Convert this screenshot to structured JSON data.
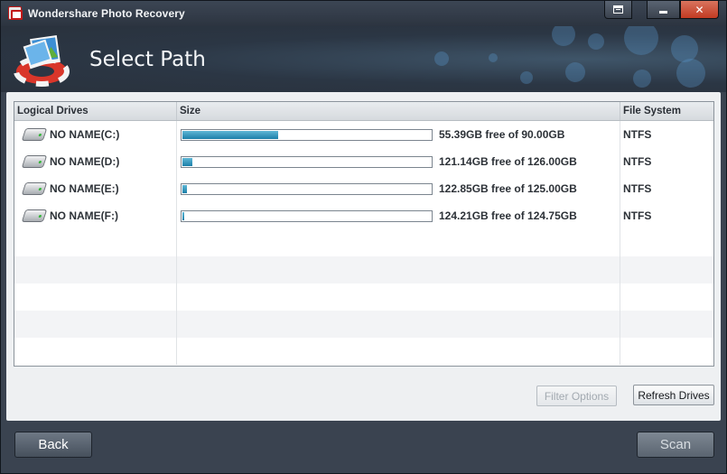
{
  "window": {
    "title": "Wondershare Photo Recovery",
    "close_glyph": "✕",
    "min_icon": "minimize-icon",
    "restore_icon": "restore-icon"
  },
  "header": {
    "page_title": "Select Path",
    "logo_icon": "photo-recovery-logo-icon"
  },
  "table": {
    "columns": [
      "Logical Drives",
      "Size",
      "File System"
    ],
    "rows": [
      {
        "drive": "NO NAME(C:)",
        "size_text": "55.39GB free of 90.00GB",
        "used_fraction": 0.385,
        "fs": "NTFS"
      },
      {
        "drive": "NO NAME(D:)",
        "size_text": "121.14GB free of 126.00GB",
        "used_fraction": 0.039,
        "fs": "NTFS"
      },
      {
        "drive": "NO NAME(E:)",
        "size_text": "122.85GB free of 125.00GB",
        "used_fraction": 0.017,
        "fs": "NTFS"
      },
      {
        "drive": "NO NAME(F:)",
        "size_text": "124.21GB free of 124.75GB",
        "used_fraction": 0.004,
        "fs": "NTFS"
      }
    ]
  },
  "buttons": {
    "filter_options": "Filter Options",
    "refresh_drives": "Refresh Drives",
    "back": "Back",
    "scan": "Scan"
  },
  "colors": {
    "bar_fill": "#1b7fa8",
    "close_button": "#c23a22"
  }
}
